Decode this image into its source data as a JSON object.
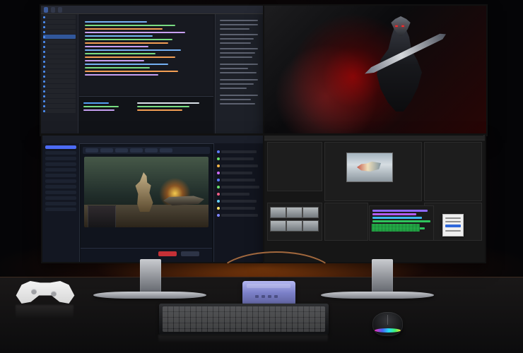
{
  "scene": {
    "accent_colors": {
      "wall_glow": "#ff7a1a",
      "mini_pc": "#8b90de",
      "mouse_rgb_1": "#ff2bbf",
      "mouse_rgb_2": "#24e9ff",
      "mouse_rgb_3": "#4cff6d",
      "mouse_rgb_4": "#ffe93a"
    }
  },
  "objects": {
    "monitors": [
      {
        "name": "top-left-monitor",
        "content": "code-editor"
      },
      {
        "name": "top-right-monitor",
        "content": "dark-fantasy-artwork"
      },
      {
        "name": "bottom-left-monitor",
        "content": "streaming-software"
      },
      {
        "name": "bottom-right-monitor",
        "content": "video-editing-software"
      }
    ],
    "devices": [
      {
        "name": "game-controller",
        "color": "#efefef"
      },
      {
        "name": "mini-pc",
        "color": "#8b90de"
      },
      {
        "name": "keyboard",
        "color": "#1e1f22"
      },
      {
        "name": "mouse",
        "color": "#151618"
      }
    ]
  }
}
